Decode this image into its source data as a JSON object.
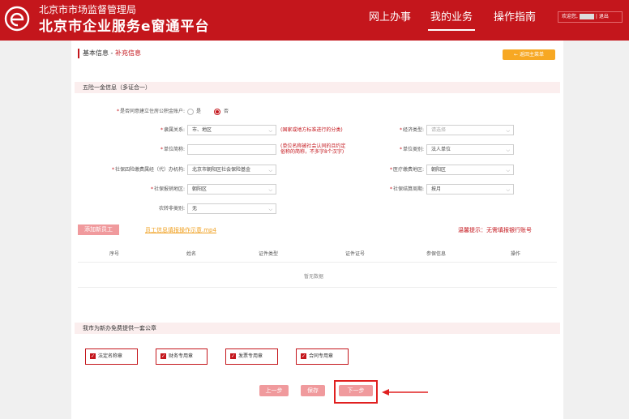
{
  "header": {
    "agency": "北京市市场监督管理局",
    "platform": "北京市企业服务e窗通平台",
    "nav": [
      "网上办事",
      "我的业务",
      "操作指南"
    ],
    "user_greeting": "欢迎您,",
    "logout": "退出"
  },
  "breadcrumb": {
    "main": "基本信息 - ",
    "sub": "补充信息"
  },
  "back_button": "← 返回主菜单",
  "section_insurance": "五险一金信息（多证合一）",
  "housing_fund": {
    "label": "是否同意建立住房公积金账户:",
    "yes": "是",
    "no": "否",
    "selected": "否"
  },
  "form": {
    "affiliation": {
      "label": "隶属关系:",
      "value": "市、地区",
      "hint": "(国家或地方标准进行的分类)"
    },
    "economic_type": {
      "label": "经济类型:",
      "placeholder": "请选择"
    },
    "unit_short_name": {
      "label": "单位简称:",
      "value": "",
      "hint_1": "(单位名称被社会认同的且约定",
      "hint_2": "俗称的简称，不多字8个汉字)"
    },
    "unit_category": {
      "label": "单位类别:",
      "value": "法人单位"
    },
    "social_agency": {
      "label": "社保四险缴费属经（代）办机构:",
      "value": "北京市朝阳区社会保险基金"
    },
    "medical_area": {
      "label": "医疗缴费地区:",
      "value": "朝阳区"
    },
    "social_area": {
      "label": "社保报销地区:",
      "value": "朝阳区"
    },
    "settlement_cycle": {
      "label": "社保结算周期:",
      "value": "按月"
    },
    "rural_type": {
      "label": "农转非类别:",
      "value": "无"
    }
  },
  "employees": {
    "add_button": "添加新员工",
    "video_link": "员工信息填报操作示意.mp4",
    "tip": "温馨提示：无需填报银行账号",
    "columns": [
      "序号",
      "姓名",
      "证件类型",
      "证件证号",
      "参保信息",
      "操作"
    ],
    "empty_text": "暂无数据"
  },
  "section_seals": "我市为新办免费提供一套公章",
  "seals": [
    "法定名称章",
    "财务专用章",
    "发票专用章",
    "合同专用章"
  ],
  "buttons": {
    "prev": "上一步",
    "save": "保存",
    "next": "下一步"
  },
  "colors": {
    "brand_red": "#c4161c",
    "button_pink": "#f09a9d",
    "accent_orange": "#f7a823"
  }
}
